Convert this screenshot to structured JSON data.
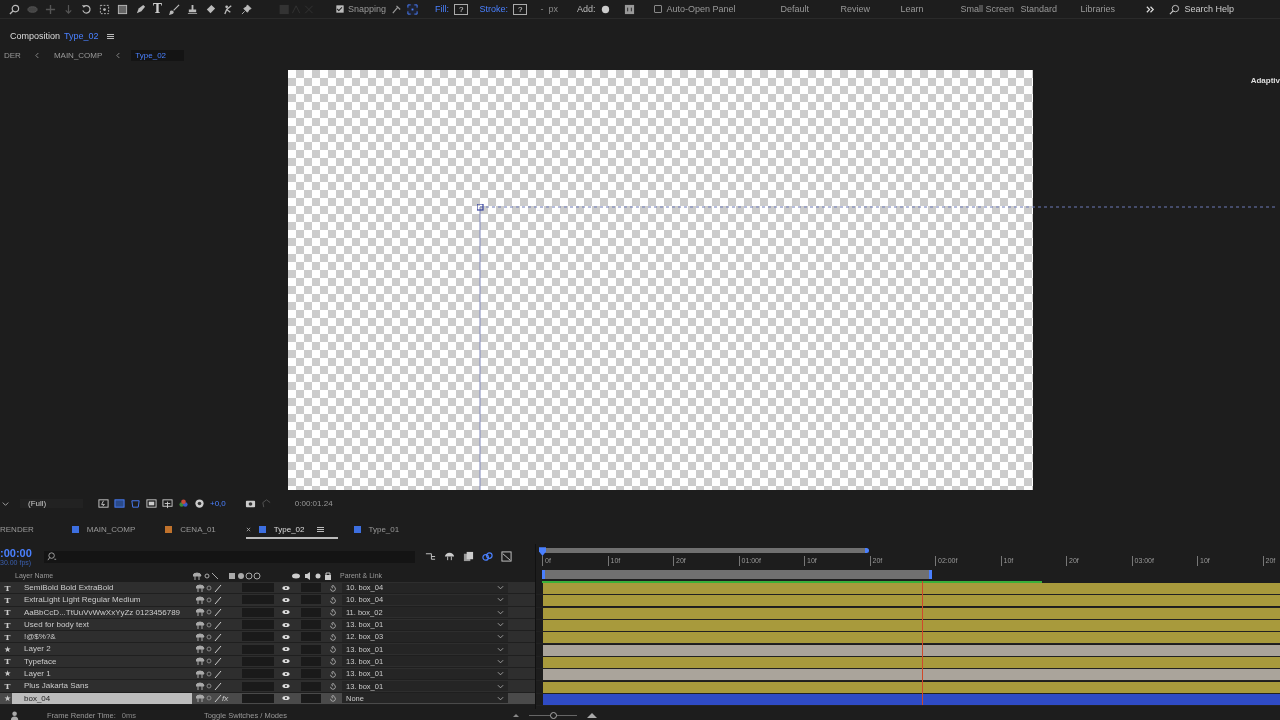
{
  "toolbar": {
    "type_tool": "T",
    "snapping": {
      "label": "Snapping",
      "checked": true
    },
    "fill": {
      "label": "Fill:",
      "value": "?"
    },
    "stroke": {
      "label": "Stroke:",
      "value": "?",
      "width": "-",
      "unit": "px"
    },
    "add": {
      "label": "Add:"
    },
    "auto_open": {
      "label": "Auto-Open Panel",
      "checked": false
    },
    "workspaces": [
      "Default",
      "Review",
      "Learn",
      "Small Screen",
      "Standard",
      "Libraries"
    ],
    "search": {
      "placeholder": "Search Help"
    }
  },
  "composition_panel": {
    "label": "Composition",
    "name": "Type_02",
    "breadcrumbs": [
      {
        "label": "DER",
        "selected": false
      },
      {
        "label": "MAIN_COMP",
        "selected": false
      },
      {
        "label": "Type_02",
        "selected": true
      }
    ],
    "side_panel_label": "Adaptiv"
  },
  "viewer_bar": {
    "resolution": "(Full)",
    "exposure": "+0,0",
    "timecode": "0:00:01.24"
  },
  "timeline_tabs": [
    {
      "label": "RENDER",
      "selected": false
    },
    {
      "label": "MAIN_COMP",
      "color": "#3d6fe0",
      "selected": false
    },
    {
      "label": "CENA_01",
      "color": "#c0722c",
      "selected": false
    },
    {
      "label": "Type_02",
      "color": "#3d6fe0",
      "selected": true
    },
    {
      "label": "Type_01",
      "color": "#3d6fe0",
      "selected": false
    }
  ],
  "timeline": {
    "current_time": ":00:00",
    "fps": "30.00 fps)",
    "columns": {
      "layer_name": "Layer Name",
      "parent": "Parent & Link"
    },
    "ruler": [
      "0f",
      "10f",
      "20f",
      "01:00f",
      "10f",
      "20f",
      "02:00f",
      "10f",
      "20f",
      "03:00f",
      "10f",
      "20f"
    ],
    "layers": [
      {
        "kind": "text",
        "icon": "T",
        "name": "SemiBold Bold ExtraBold",
        "parent": "10. box_04",
        "color": "#a89a3c",
        "selected": false
      },
      {
        "kind": "text",
        "icon": "T",
        "name": "ExtraLight Light Regular Medium",
        "parent": "10. box_04",
        "color": "#a89a3c",
        "selected": false
      },
      {
        "kind": "text",
        "icon": "T",
        "name": "AaBbCcD...TtUuVvWwXxYyZz 0123456789",
        "parent": "11. box_02",
        "color": "#a89a3c",
        "selected": false
      },
      {
        "kind": "text",
        "icon": "T",
        "name": "Used for body text",
        "parent": "13. box_01",
        "color": "#a89a3c",
        "selected": false
      },
      {
        "kind": "text",
        "icon": "T",
        "name": "!@$%?&",
        "parent": "12. box_03",
        "color": "#a89a3c",
        "selected": false
      },
      {
        "kind": "shape",
        "icon": "★",
        "name": "Layer 2",
        "parent": "13. box_01",
        "color": "#aaa49b",
        "selected": false
      },
      {
        "kind": "text",
        "icon": "T",
        "name": "Typeface",
        "parent": "13. box_01",
        "color": "#a89a3c",
        "selected": false
      },
      {
        "kind": "shape",
        "icon": "★",
        "name": "Layer 1",
        "parent": "13. box_01",
        "color": "#aaa49b",
        "selected": false
      },
      {
        "kind": "text",
        "icon": "T",
        "name": "Plus Jakarta Sans",
        "parent": "13. box_01",
        "color": "#a89a3c",
        "selected": false
      },
      {
        "kind": "shape",
        "icon": "★",
        "name": "box_04",
        "parent": "None",
        "color": "#2f4bc4",
        "selected": true,
        "fx": "fx"
      }
    ]
  },
  "status_bar": {
    "zoom": {
      "level": 0.5
    },
    "render_label": "Frame Render Time:",
    "render_value": "0ms",
    "toggle": "Toggle Switches / Modes"
  }
}
